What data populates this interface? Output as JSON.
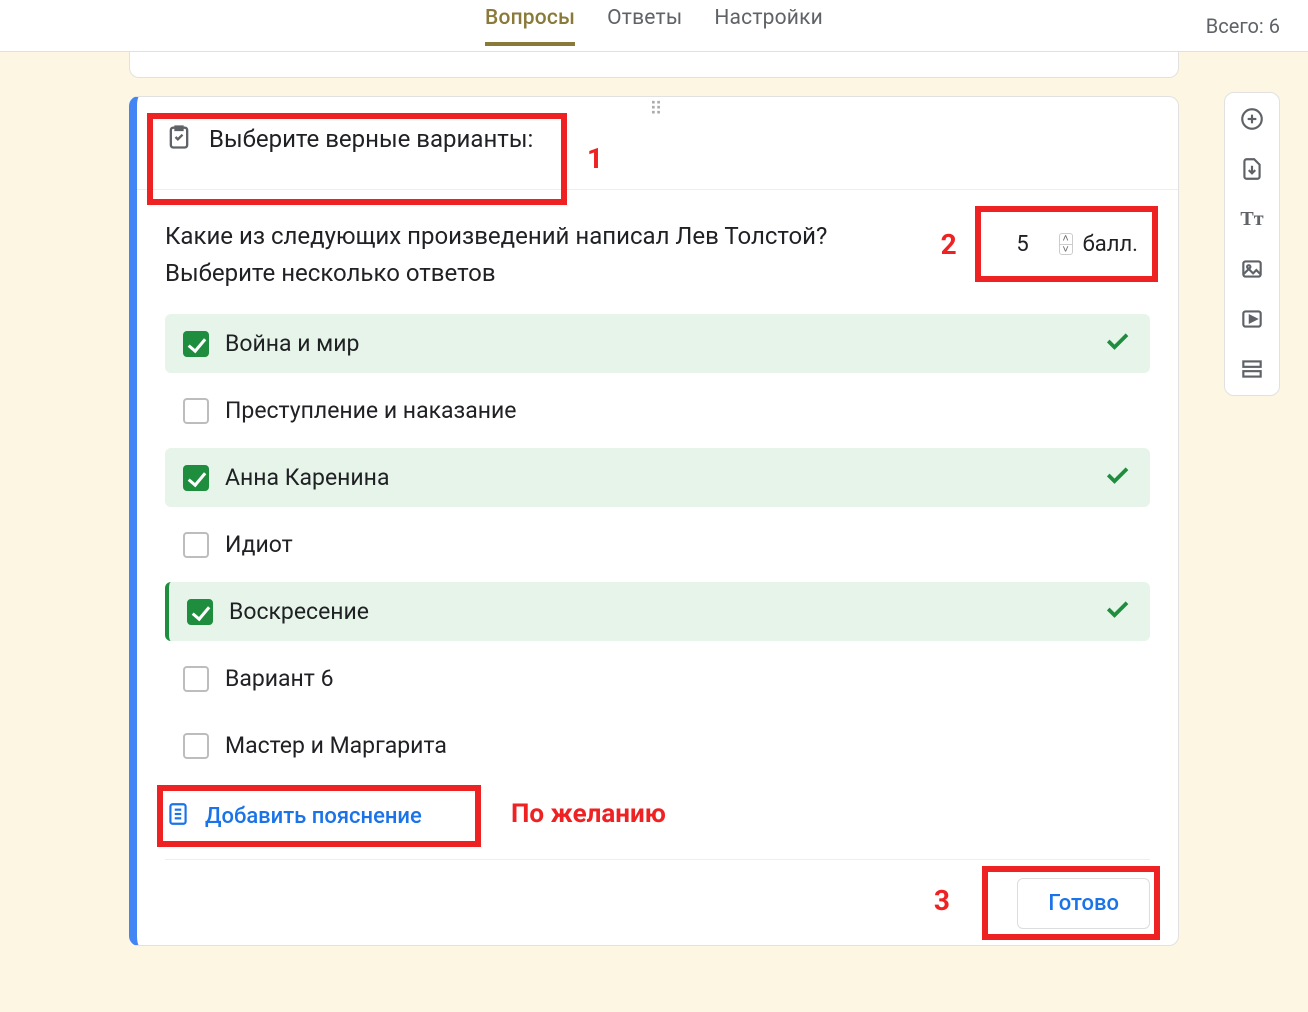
{
  "header": {
    "tabs": {
      "questions": "Вопросы",
      "answers": "Ответы",
      "settings": "Настройки"
    },
    "total_prefix": "Всего:",
    "total_value": "6"
  },
  "question": {
    "section_title": "Выберите верные варианты:",
    "text_line1": "Какие из следующих произведений написал Лев Толстой?",
    "text_line2": "Выберите несколько ответов",
    "points_value": "5",
    "points_label": "балл.",
    "options": [
      {
        "label": "Война и мир",
        "correct": true
      },
      {
        "label": "Преступление и наказание",
        "correct": false
      },
      {
        "label": "Анна Каренина",
        "correct": true
      },
      {
        "label": "Идиот",
        "correct": false
      },
      {
        "label": "Воскресение",
        "correct": true
      },
      {
        "label": "Вариант 6",
        "correct": false
      },
      {
        "label": "Мастер и Маргарита",
        "correct": false
      }
    ],
    "add_explanation": "Добавить пояснение",
    "done": "Готово"
  },
  "annotations": {
    "n1": "1",
    "n2": "2",
    "n3": "3",
    "optional": "По желанию"
  },
  "colors": {
    "accent_active_tab": "#8a7a3a",
    "card_left_border": "#4285f4",
    "correct_green": "#1e8e3e",
    "correct_bg": "#e6f4ea",
    "link_blue": "#1a73e8",
    "callout_red": "#e22"
  }
}
